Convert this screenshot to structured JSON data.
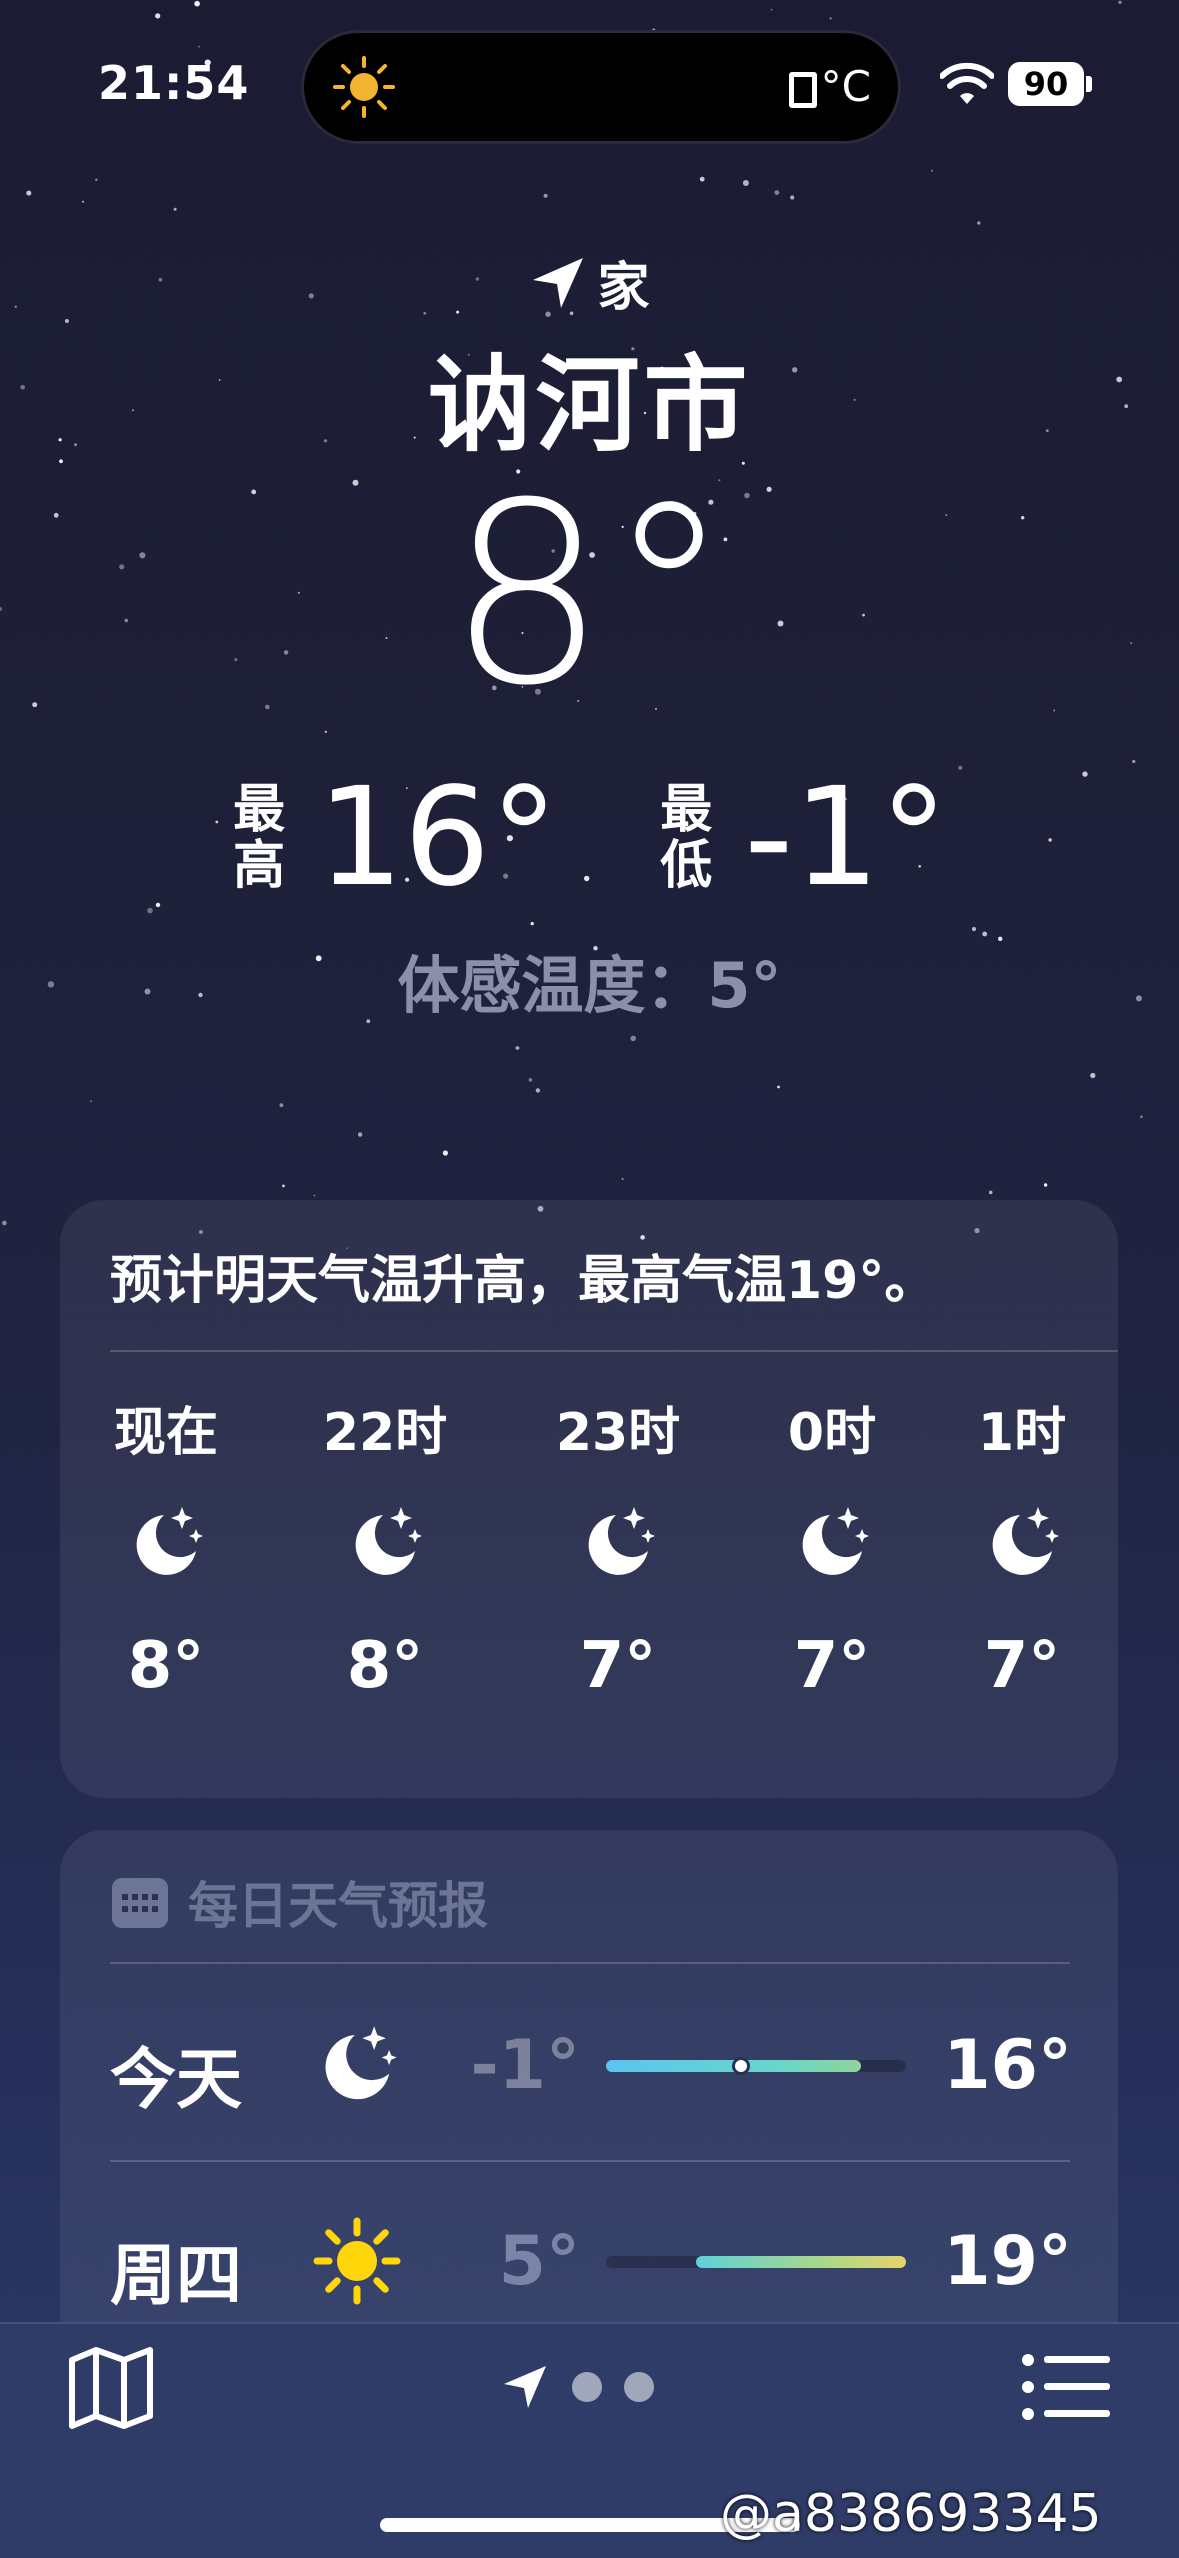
{
  "status_bar": {
    "time": "21:54",
    "island_temp_unit": "°C",
    "battery": "90"
  },
  "location": {
    "label": "家",
    "city": "讷河市"
  },
  "current": {
    "temp": "8°",
    "high_label": "最\n高",
    "high": "16°",
    "low_label": "最\n低",
    "low": "-1°",
    "feels_like": "体感温度：5°"
  },
  "hourly": {
    "summary": "预计明天气温升高，最高气温19°。",
    "items": [
      {
        "time": "现在",
        "icon": "moon-stars-icon",
        "temp": "8°"
      },
      {
        "time": "22时",
        "icon": "moon-stars-icon",
        "temp": "8°"
      },
      {
        "time": "23时",
        "icon": "moon-stars-icon",
        "temp": "7°"
      },
      {
        "time": "0时",
        "icon": "moon-stars-icon",
        "temp": "7°"
      },
      {
        "time": "1时",
        "icon": "moon-stars-icon",
        "temp": "7°"
      }
    ]
  },
  "daily": {
    "title": "每日天气预报",
    "items": [
      {
        "day": "今天",
        "icon": "moon-stars-icon",
        "low": "-1°",
        "high": "16°",
        "range_low": -1,
        "range_high": 16,
        "current": 8
      },
      {
        "day": "周四",
        "icon": "sun-icon",
        "low": "5°",
        "high": "19°",
        "range_low": 5,
        "range_high": 19
      }
    ],
    "scale": {
      "min": -1,
      "max": 19
    }
  },
  "watermark": "@a838693345",
  "colors": {
    "accent_today": "#5bc4f0",
    "accent_tomorrow": "#e6d46a",
    "sun": "#ffd60a"
  }
}
